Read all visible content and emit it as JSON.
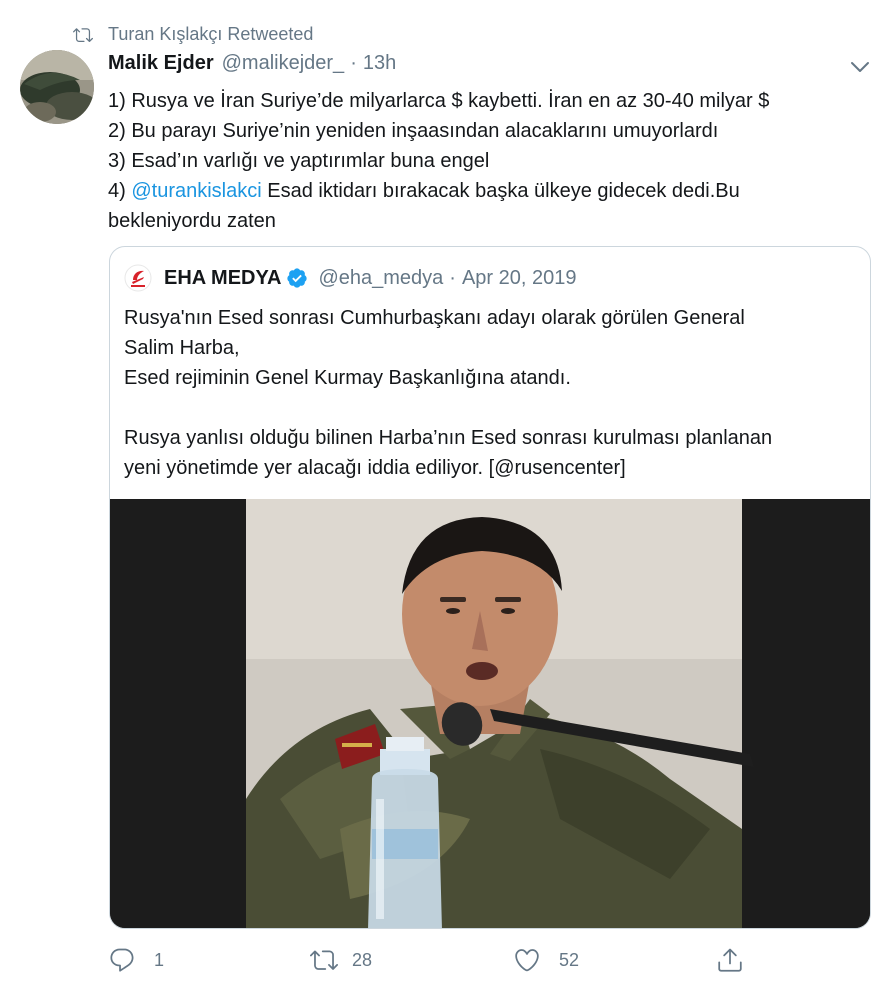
{
  "retweet": {
    "icon": "retweet-icon",
    "label": "Turan Kışlakçı Retweeted"
  },
  "tweet": {
    "author_name": "Malik Ejder",
    "author_handle": "@malikejder_",
    "separator": "·",
    "time": "13h",
    "lines": [
      "1) Rusya ve İran Suriye’de milyarlarca $ kaybetti. İran en az 30-40 milyar $",
      "2) Bu parayı Suriye’nin yeniden inşaasından alacaklarını umuyorlardı",
      "3) Esad’ın varlığı ve yaptırımlar buna engel",
      "4) ",
      "@turankislakci",
      " Esad iktidarı bırakacak başka ülkeye gidecek dedi.Bu",
      "bekleniyordu zaten"
    ]
  },
  "quote": {
    "name": "EHA MEDYA",
    "handle": "@eha_medya",
    "separator": "·",
    "date": "Apr 20, 2019",
    "lines": [
      "Rusya'nın Esed sonrası Cumhurbaşkanı adayı olarak görülen General",
      "Salim Harba,",
      "Esed rejiminin Genel Kurmay Başkanlığına atandı.",
      "",
      "Rusya yanlısı olduğu bilinen Harba’nın Esed sonrası kurulması planlanan",
      "yeni yönetimde yer alacağı iddia ediliyor. [@rusencenter]"
    ]
  },
  "actions": {
    "reply_count": "1",
    "retweet_count": "28",
    "like_count": "52"
  },
  "colors": {
    "link": "#1b95e0",
    "secondary_text": "#657786",
    "verified": "#1da1f2",
    "border": "#ccd6dd"
  }
}
